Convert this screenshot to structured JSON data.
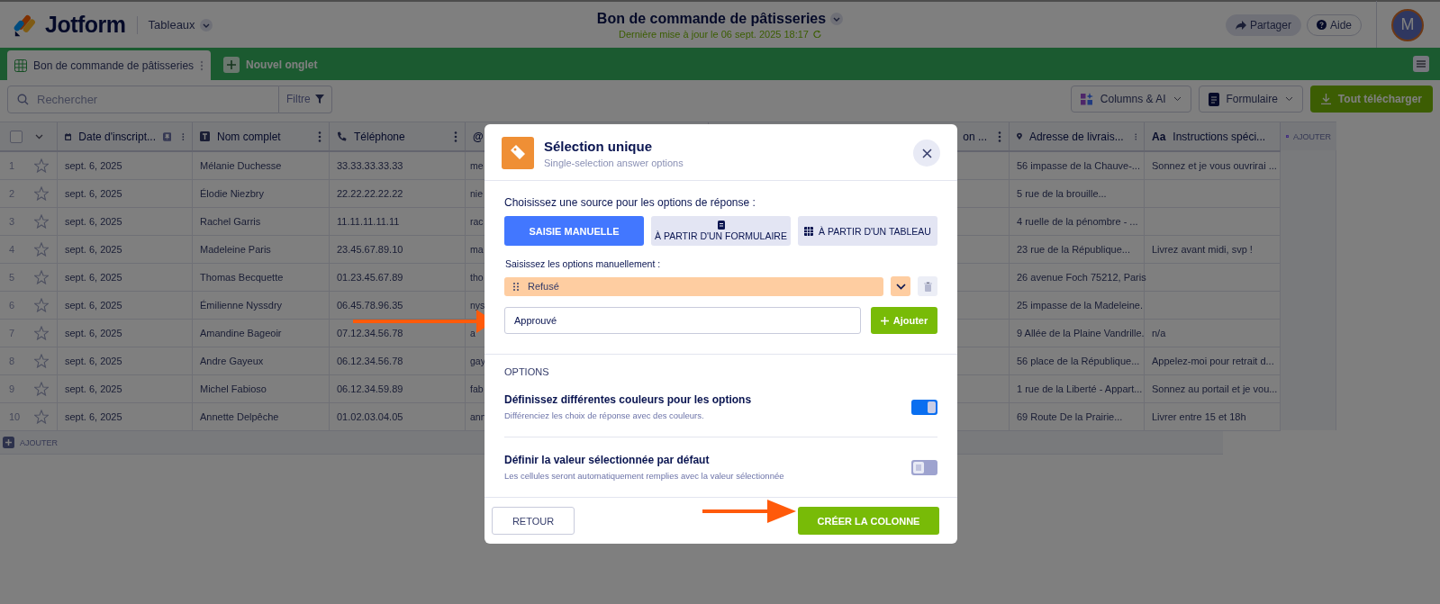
{
  "app": {
    "logo": "Jotform",
    "section": "Tableaux"
  },
  "document": {
    "title": "Bon de commande de pâtisseries",
    "updated": "Dernière mise à jour le 06 sept. 2025 18:17"
  },
  "header_buttons": [
    {
      "kind": "share",
      "label": "Partager"
    },
    {
      "kind": "help",
      "label": "Aide"
    }
  ],
  "avatar": {
    "initial": "M"
  },
  "tabs": [
    {
      "label": "Bon de commande de pâtisseries",
      "selected": true
    },
    {
      "label": "Nouvel onglet",
      "selected": false
    }
  ],
  "toolbar": {
    "search": {
      "placeholder": "Rechercher"
    },
    "filter": "Filtre",
    "columns_button": "Columns & AI",
    "form_button": "Formulaire",
    "download_button": "Tout télécharger"
  },
  "table": {
    "columns": [
      {
        "kind": "date",
        "label": "Date d'inscript...",
        "pinned": true
      },
      {
        "kind": "text",
        "label": "Nom complet"
      },
      {
        "kind": "phone",
        "label": "Téléphone"
      },
      {
        "kind": "email",
        "glyph": "@"
      },
      {
        "kind": "unknown",
        "label": "on ..."
      },
      {
        "kind": "address",
        "label": "Adresse de livrais..."
      },
      {
        "kind": "longtext",
        "glyph": "Aa",
        "label": "Instructions spéci..."
      }
    ],
    "add_column": "AJOUTER",
    "select_all_checked": false,
    "rows": [
      {
        "number": "1",
        "starred": false,
        "cells": [
          "sept. 6, 2025",
          "Mélanie Duchesse",
          "33.33.33.33.33",
          "me",
          "",
          "56 impasse de la Chauve-...",
          "Sonnez et je vous ouvrirai ..."
        ]
      },
      {
        "number": "2",
        "starred": false,
        "cells": [
          "sept. 6, 2025",
          "Élodie Niezbry",
          "22.22.22.22.22",
          "nie",
          "",
          "5 rue de la brouille...",
          ""
        ]
      },
      {
        "number": "3",
        "starred": false,
        "cells": [
          "sept. 6, 2025",
          "Rachel Garris",
          "11.11.11.11.11",
          "rac",
          "",
          "4 ruelle de la pénombre - ...",
          ""
        ]
      },
      {
        "number": "4",
        "starred": false,
        "cells": [
          "sept. 6, 2025",
          "Madeleine Paris",
          "23.45.67.89.10",
          "ma",
          "",
          "23 rue de la République...",
          "Livrez avant midi, svp !"
        ]
      },
      {
        "number": "5",
        "starred": false,
        "cells": [
          "sept. 6, 2025",
          "Thomas Becquette",
          "01.23.45.67.89",
          "tho",
          "",
          "26 avenue Foch 75212, Paris",
          ""
        ]
      },
      {
        "number": "6",
        "starred": false,
        "cells": [
          "sept. 6, 2025",
          "Émilienne Nyssdry",
          "06.45.78.96.35",
          "nys",
          "",
          "25 impasse de la Madeleine.",
          ""
        ]
      },
      {
        "number": "7",
        "starred": false,
        "cells": [
          "sept. 6, 2025",
          "Amandine Bageoir",
          "07.12.34.56.78",
          "a",
          "",
          "9 Allée de la Plaine Vandrille.",
          "n/a"
        ]
      },
      {
        "number": "8",
        "starred": false,
        "cells": [
          "sept. 6, 2025",
          "Andre Gayeux",
          "06.12.34.56.78",
          "gay",
          "",
          "56 place de la République...",
          "Appelez-moi pour retrait d..."
        ]
      },
      {
        "number": "9",
        "starred": false,
        "cells": [
          "sept. 6, 2025",
          "Michel Fabioso",
          "06.12.34.59.89",
          "fab",
          "",
          "1 rue de la Liberté - Appart...",
          "Sonnez au portail et je vou..."
        ]
      },
      {
        "number": "10",
        "starred": false,
        "cells": [
          "sept. 6, 2025",
          "Annette Delpêche",
          "01.02.03.04.05",
          "ann",
          "",
          "69 Route De la Prairie...",
          "Livrer entre 15 et 18h"
        ]
      }
    ],
    "add_row": "AJOUTER"
  },
  "dialog": {
    "title": "Sélection unique",
    "subtitle": "Single-selection answer options",
    "source_prompt": "Choisissez une source pour les options de réponse :",
    "sources": [
      {
        "kind": "manual",
        "label": "SAISIE MANUELLE",
        "selected": true
      },
      {
        "kind": "form",
        "label": "À PARTIR D'UN FORMULAIRE",
        "selected": false
      },
      {
        "kind": "table",
        "label": "À PARTIR D'UN TABLEAU",
        "selected": false
      }
    ],
    "options_prompt": "Saisissez les options manuellement :",
    "options": [
      {
        "label": "Refusé",
        "color": "#fecda1"
      }
    ],
    "new_option": {
      "value": "Approuvé"
    },
    "add_button": "Ajouter",
    "settings_heading": "OPTIONS",
    "settings": [
      {
        "title": "Définissez différentes couleurs pour les options",
        "description": "Différenciez les choix de réponse avec des couleurs.",
        "on": true
      },
      {
        "title": "Définir la valeur sélectionnée par défaut",
        "description": "Les cellules seront automatiquement remplies avec la valeur sélectionnée",
        "on": false
      }
    ],
    "back_button": "RETOUR",
    "create_button": "CRÉER LA COLONNE"
  }
}
